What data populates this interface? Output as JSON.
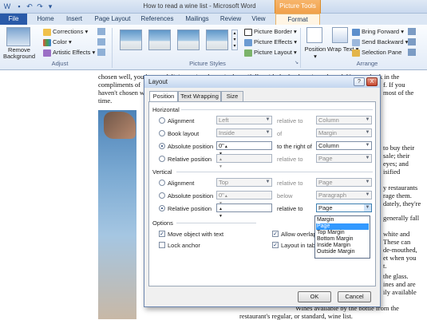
{
  "window": {
    "title": "How to read a wine list - Microsoft Word",
    "context_tool": "Picture Tools"
  },
  "tabs": [
    "File",
    "Home",
    "Insert",
    "Page Layout",
    "References",
    "Mailings",
    "Review",
    "View",
    "Format"
  ],
  "ribbon": {
    "remove_background": "Remove Background",
    "corrections": "Corrections",
    "color": "Color",
    "artistic_effects": "Artistic Effects",
    "adjust_label": "Adjust",
    "picture_border": "Picture Border",
    "picture_effects": "Picture Effects",
    "picture_layout": "Picture Layout",
    "picture_styles_label": "Picture Styles",
    "position": "Position",
    "wrap_text": "Wrap Text",
    "bring_forward": "Bring Forward",
    "send_backward": "Send Backward",
    "selection_pane": "Selection Pane",
    "arrange_label": "Arrange"
  },
  "document": {
    "lines_top": [
      "chosen well, you have a delicious wine that pairs beautifully with the food you've selected. You can bask in the",
      "compliments of",
      "haven't chosen w",
      "time."
    ],
    "right_fragments": [
      "f. If you",
      "most of the",
      "to buy their",
      "sale; their",
      "eyes; and",
      "isified",
      "y restaurants",
      "rage them.",
      "dately, they're",
      "generally fall",
      "white and",
      "These can",
      "de-mouthed,",
      "et when you",
      "t.",
      "the glass.",
      "ines and are",
      "ily available"
    ],
    "bottom_lines": [
      "Wines available by the bottle from the",
      "restaurant's regular, or standard, wine list."
    ]
  },
  "dialog": {
    "title": "Layout",
    "help": "?",
    "close": "X",
    "tabs": [
      "Position",
      "Text Wrapping",
      "Size"
    ],
    "horizontal": {
      "section": "Horizontal",
      "rows": [
        {
          "label": "Alignment",
          "value": "Left",
          "rel_label": "relative to",
          "rel_value": "Column",
          "selected": false
        },
        {
          "label": "Book layout",
          "value": "Inside",
          "rel_label": "of",
          "rel_value": "Margin",
          "selected": false
        },
        {
          "label": "Absolute position",
          "value": "0\"",
          "rel_label": "to the right of",
          "rel_value": "Column",
          "selected": true
        },
        {
          "label": "Relative position",
          "value": "",
          "rel_label": "relative to",
          "rel_value": "Page",
          "selected": false
        }
      ]
    },
    "vertical": {
      "section": "Vertical",
      "rows": [
        {
          "label": "Alignment",
          "value": "Top",
          "rel_label": "relative to",
          "rel_value": "Page",
          "selected": false
        },
        {
          "label": "Absolute position",
          "value": "0\"",
          "rel_label": "below",
          "rel_value": "Paragraph",
          "selected": false
        },
        {
          "label": "Relative position",
          "value": "",
          "rel_label": "relative to",
          "rel_value": "Page",
          "selected": true
        }
      ]
    },
    "options": {
      "section": "Options",
      "move_object": "Move object with text",
      "lock_anchor": "Lock anchor",
      "allow_overlap": "Allow overlap",
      "layout_in_table": "Layout in table cell"
    },
    "dropdown_options": [
      "Margin",
      "Page",
      "Top Margin",
      "Bottom Margin",
      "Inside Margin",
      "Outside Margin"
    ],
    "dropdown_selected": "Page",
    "ok": "OK",
    "cancel": "Cancel"
  }
}
